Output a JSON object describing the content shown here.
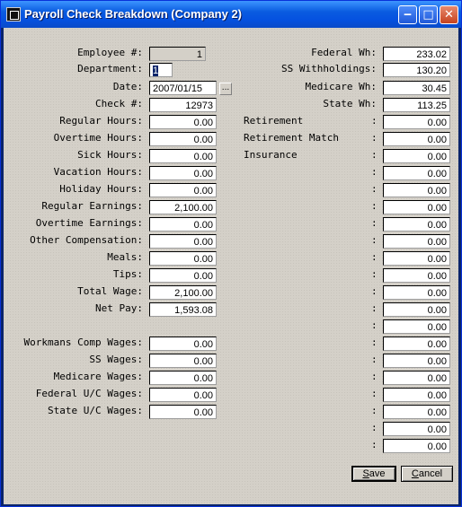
{
  "window": {
    "title": "Payroll Check Breakdown (Company 2)",
    "icons": [
      "app-icon",
      "minimize-icon",
      "maximize-icon",
      "close-icon"
    ]
  },
  "left": {
    "employee_label": "Employee #:",
    "employee": "1",
    "department_label": "Department:",
    "department": "1",
    "date_label": "Date:",
    "date": "2007/01/15",
    "date_button": "...",
    "check_label": "Check #:",
    "check": "12973",
    "regular_hours_label": "Regular Hours:",
    "regular_hours": "0.00",
    "overtime_hours_label": "Overtime Hours:",
    "overtime_hours": "0.00",
    "sick_hours_label": "Sick Hours:",
    "sick_hours": "0.00",
    "vacation_hours_label": "Vacation Hours:",
    "vacation_hours": "0.00",
    "holiday_hours_label": "Holiday Hours:",
    "holiday_hours": "0.00",
    "regular_earnings_label": "Regular Earnings:",
    "regular_earnings": "2,100.00",
    "overtime_earnings_label": "Overtime Earnings:",
    "overtime_earnings": "0.00",
    "other_comp_label": "Other Compensation:",
    "other_comp": "0.00",
    "meals_label": "Meals:",
    "meals": "0.00",
    "tips_label": "Tips:",
    "tips": "0.00",
    "total_wage_label": "Total Wage:",
    "total_wage": "2,100.00",
    "net_pay_label": "Net Pay:",
    "net_pay": "1,593.08",
    "workmans_comp_label": "Workmans Comp Wages:",
    "workmans_comp": "0.00",
    "ss_wages_label": "SS Wages:",
    "ss_wages": "0.00",
    "medicare_wages_label": "Medicare Wages:",
    "medicare_wages": "0.00",
    "federal_uc_label": "Federal U/C Wages:",
    "federal_uc": "0.00",
    "state_uc_label": "State U/C Wages:",
    "state_uc": "0.00"
  },
  "right": {
    "federal_wh_label": "Federal Wh:",
    "federal_wh": "233.02",
    "ss_withholdings_label": "SS Withholdings:",
    "ss_withholdings": "130.20",
    "medicare_wh_label": "Medicare Wh:",
    "medicare_wh": "30.45",
    "state_wh_label": "State Wh:",
    "state_wh": "113.25",
    "retirement_label": "Retirement",
    "retirement": "0.00",
    "retirement_match_label": "Retirement Match",
    "retirement_match": "0.00",
    "insurance_label": "Insurance",
    "insurance": "0.00",
    "colon": ":",
    "extra_values": [
      "0.00",
      "0.00",
      "0.00",
      "0.00",
      "0.00",
      "0.00",
      "0.00",
      "0.00",
      "0.00",
      "0.00",
      "0.00",
      "0.00",
      "0.00",
      "0.00",
      "0.00",
      "0.00",
      "0.00"
    ]
  },
  "buttons": {
    "save": "Save",
    "cancel": "Cancel"
  }
}
